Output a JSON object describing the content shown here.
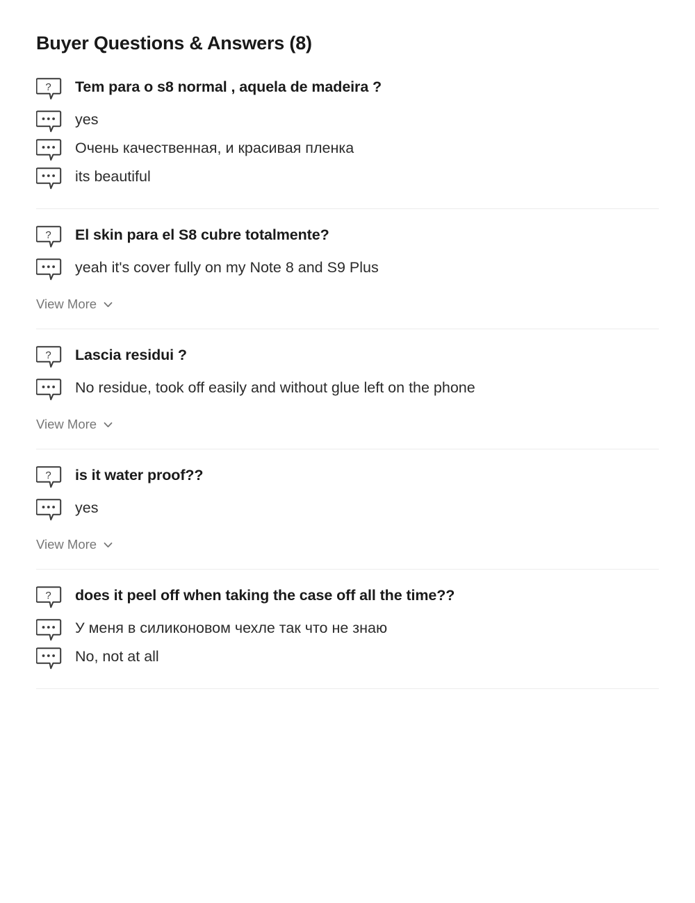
{
  "panel": {
    "title": "Buyer Questions & Answers (8)",
    "view_more_label": "View More",
    "icons": {
      "question": "question-bubble-icon",
      "answer": "answer-bubble-icon",
      "chevron": "chevron-down-icon"
    },
    "colors": {
      "text": "#2b2b2b",
      "heading": "#191919",
      "muted": "#777777",
      "divider": "#ececec",
      "background": "#ffffff"
    }
  },
  "qa_blocks": [
    {
      "question": "Tem para o s8 normal , aquela de madeira ?",
      "answers": [
        "yes",
        "Очень качественная, и красивая пленка",
        "its beautiful"
      ],
      "has_view_more": false,
      "divider_after": true
    },
    {
      "question": "El skin para el S8 cubre totalmente?",
      "answers": [
        "yeah it's cover fully on my Note 8 and S9 Plus"
      ],
      "has_view_more": true,
      "divider_after": true
    },
    {
      "question": "Lascia residui ?",
      "answers": [
        "No residue, took off easily and without glue left on the phone"
      ],
      "has_view_more": true,
      "divider_after": true
    },
    {
      "question": "is it water proof??",
      "answers": [
        "yes"
      ],
      "has_view_more": true,
      "divider_after": true
    },
    {
      "question": "does it peel off when taking the case off all the time??",
      "answers": [
        "У меня в силиконовом чехле так что не знаю",
        "No, not at all"
      ],
      "has_view_more": false,
      "divider_after": true
    }
  ]
}
